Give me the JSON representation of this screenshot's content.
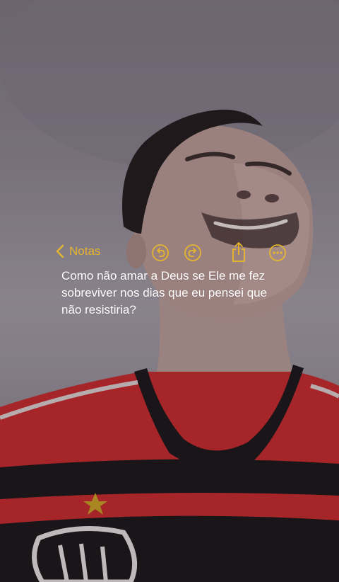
{
  "colors": {
    "accent": "#e5b530",
    "note_text": "#ffffff",
    "jersey_red": "#c62a2c",
    "jersey_black": "#1b1719"
  },
  "toolbar": {
    "back_label": "Notas",
    "back_icon": "chevron-left-icon",
    "buttons": [
      {
        "name": "undo",
        "icon": "undo-circle-icon"
      },
      {
        "name": "redo",
        "icon": "redo-circle-icon"
      },
      {
        "name": "share",
        "icon": "share-icon"
      },
      {
        "name": "more",
        "icon": "ellipsis-circle-icon"
      }
    ]
  },
  "note": {
    "body": "Como não amar a Deus se Ele me fez\nsobreviver nos dias que eu pensei que\nnão resistiria?"
  }
}
